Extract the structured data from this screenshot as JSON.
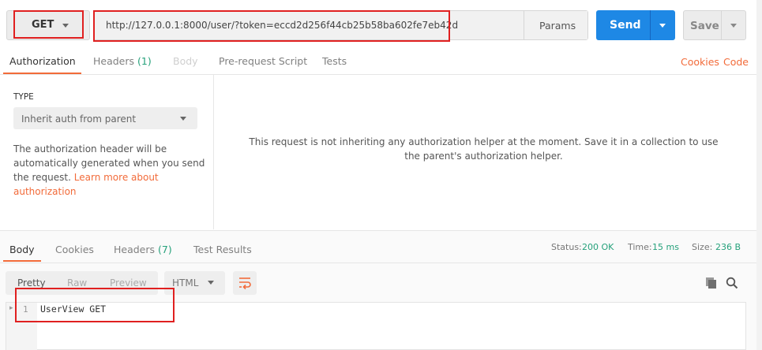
{
  "request": {
    "method": "GET",
    "url": "http://127.0.0.1:8000/user/?token=eccd2d256f44cb25b58ba602fe7eb42d",
    "params_label": "Params",
    "send_label": "Send",
    "save_label": "Save"
  },
  "request_tabs": {
    "authorization": "Authorization",
    "headers": "Headers",
    "headers_count": "(1)",
    "body": "Body",
    "prerequest": "Pre-request Script",
    "tests": "Tests",
    "cookies_link": "Cookies",
    "code_link": "Code"
  },
  "auth": {
    "type_label": "TYPE",
    "type_value": "Inherit auth from parent",
    "desc_1": "The authorization header will be automatically generated when you send the request. ",
    "desc_link": "Learn more about authorization",
    "message": "This request is not inheriting any authorization helper at the moment. Save it in a collection to use the parent's authorization helper."
  },
  "response_tabs": {
    "body": "Body",
    "cookies": "Cookies",
    "headers": "Headers",
    "headers_count": "(7)",
    "test_results": "Test Results"
  },
  "status": {
    "status_label": "Status:",
    "status_value": "200 OK",
    "time_label": "Time:",
    "time_value": "15 ms",
    "size_label": "Size:",
    "size_value": "236 B"
  },
  "view": {
    "pretty": "Pretty",
    "raw": "Raw",
    "preview": "Preview",
    "language": "HTML"
  },
  "editor": {
    "line_number": "1",
    "line_text": "UserView GET"
  },
  "colors": {
    "accent_orange": "#f26b3a",
    "send_blue": "#1e88e5",
    "status_green": "#26a17b",
    "annotation_red": "#e02020"
  }
}
